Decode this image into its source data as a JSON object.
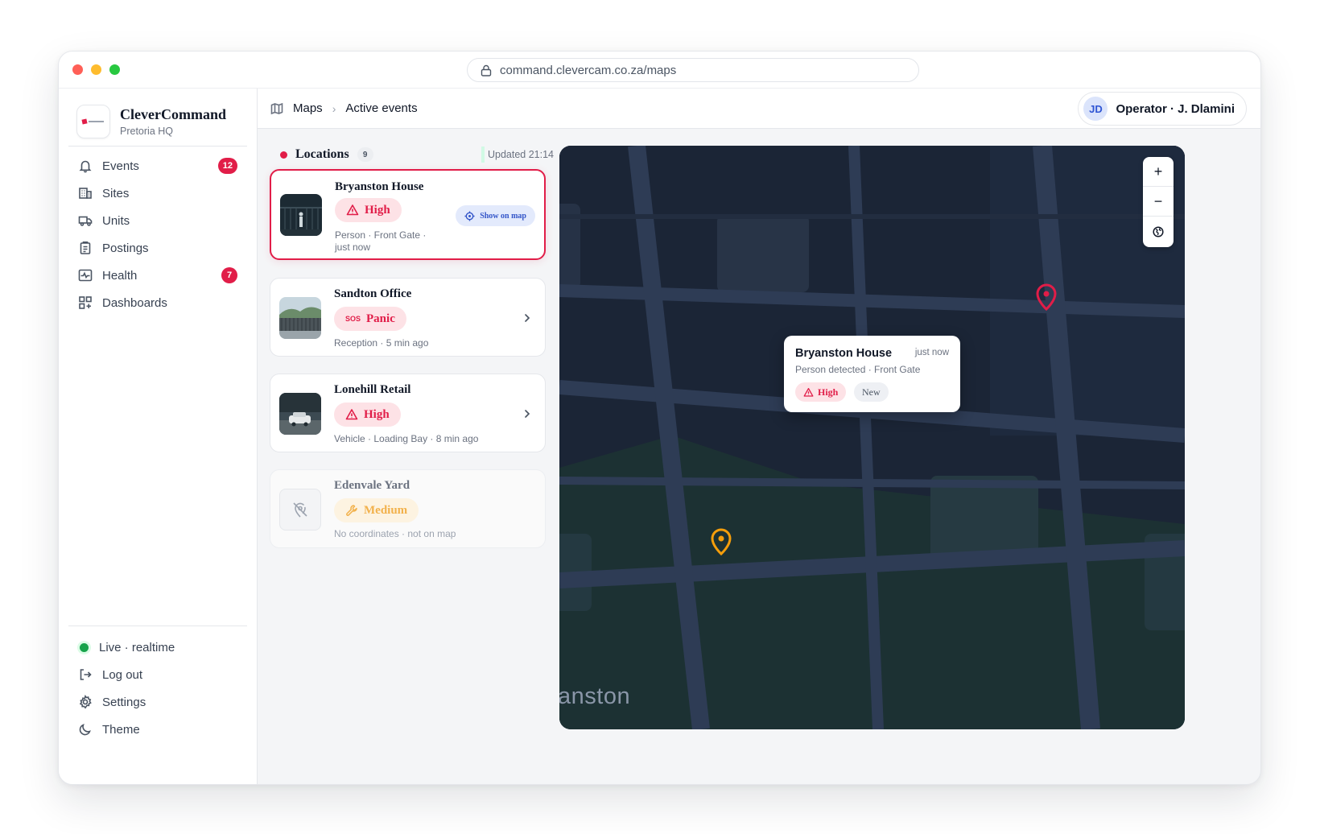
{
  "browser": {
    "url": "command.clevercam.co.za/maps"
  },
  "sidebar": {
    "brand": {
      "title": "CleverCommand",
      "subtitle": "Pretoria HQ"
    },
    "nav": [
      {
        "label": "Events",
        "icon": "bell-icon",
        "badge": "12"
      },
      {
        "label": "Sites",
        "icon": "building-icon"
      },
      {
        "label": "Units",
        "icon": "truck-icon"
      },
      {
        "label": "Postings",
        "icon": "clipboard-icon"
      },
      {
        "label": "Health",
        "icon": "pulse-icon",
        "badge": "7"
      },
      {
        "label": "Dashboards",
        "icon": "grid-icon"
      }
    ],
    "footer": [
      {
        "label": "Live · realtime",
        "icon": "status-dot"
      },
      {
        "label": "Log out",
        "icon": "logout-icon"
      },
      {
        "label": "Settings",
        "icon": "gear-icon"
      },
      {
        "label": "Theme",
        "icon": "moon-icon"
      }
    ]
  },
  "header": {
    "breadcrumb": [
      "Maps",
      "Active events"
    ],
    "operator": {
      "initials": "JD",
      "label": "Operator · J. Dlamini"
    }
  },
  "locations": {
    "title": "Locations",
    "count": "9",
    "updated": "Updated 21:14",
    "items": [
      {
        "name": "Bryanston House",
        "severity": "High",
        "meta_line1": "Person · Front Gate ·",
        "meta_line2": "just now",
        "action": "Show on map"
      },
      {
        "name": "Sandton Office",
        "severity": "Panic",
        "severity_prefix": "SOS",
        "meta_line1": "Reception · 5 min ago"
      },
      {
        "name": "Lonehill Retail",
        "severity": "High",
        "meta_line1": "Vehicle · Loading Bay · 8 min ago"
      },
      {
        "name": "Edenvale Yard",
        "severity": "Medium",
        "meta_line1": "No coordinates · not on map"
      }
    ]
  },
  "map": {
    "controls": {
      "zoom_in": "+",
      "zoom_out": "−"
    },
    "area_label": "anston",
    "popup": {
      "title": "Bryanston House",
      "time": "just now",
      "detail": "Person detected · Front Gate",
      "severity": "High",
      "status": "New"
    },
    "colors": {
      "high": "#e11d48",
      "medium": "#f59e0b",
      "map_bg": "#1b2536"
    }
  }
}
